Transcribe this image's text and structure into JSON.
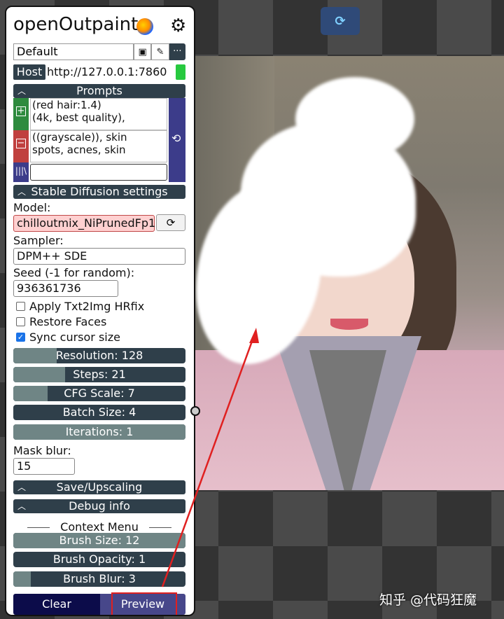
{
  "app": {
    "title": "openOutpaint"
  },
  "presets": {
    "value": "Default"
  },
  "host": {
    "label": "Host",
    "value": "http://127.0.0.1:7860",
    "status_color": "#27c93f"
  },
  "sections": {
    "prompts": "Prompts",
    "sd_settings": "Stable Diffusion settings",
    "save_upscaling": "Save/Upscaling",
    "debug_info": "Debug info",
    "context_menu": "Context Menu"
  },
  "prompts": {
    "positive_lines": [
      "(red hair:1.4)",
      "(4k, best quality),"
    ],
    "negative_lines": [
      "((grayscale)), skin",
      "spots, acnes, skin"
    ]
  },
  "model": {
    "label": "Model:",
    "value": "chilloutmix_NiPrunedFp1"
  },
  "sampler": {
    "label": "Sampler:",
    "value": "DPM++ SDE"
  },
  "seed": {
    "label": "Seed (-1 for random):",
    "value": "936361736"
  },
  "options": [
    {
      "label": "Apply Txt2Img HRfix",
      "checked": false
    },
    {
      "label": "Restore Faces",
      "checked": false
    },
    {
      "label": "Sync cursor size",
      "checked": true
    }
  ],
  "sliders": {
    "resolution": {
      "label": "Resolution: 128",
      "fill": 0.25
    },
    "steps": {
      "label": "Steps: 21",
      "fill": 0.3
    },
    "cfg": {
      "label": "CFG Scale: 7",
      "fill": 0.2
    },
    "batch": {
      "label": "Batch Size: 4",
      "fill": 0.0
    },
    "iterations": {
      "label": "Iterations: 1",
      "fill": 1.0
    }
  },
  "mask_blur": {
    "label": "Mask blur:",
    "value": "15"
  },
  "context": {
    "brush_size": {
      "label": "Brush Size: 12",
      "fill": 1.0
    },
    "brush_opacity": {
      "label": "Brush Opacity: 1",
      "fill": 0.0
    },
    "brush_blur": {
      "label": "Brush Blur: 3",
      "fill": 0.1
    }
  },
  "actions": {
    "clear": "Clear",
    "preview": "Preview"
  },
  "watermark": "知乎 @代码狂魔"
}
